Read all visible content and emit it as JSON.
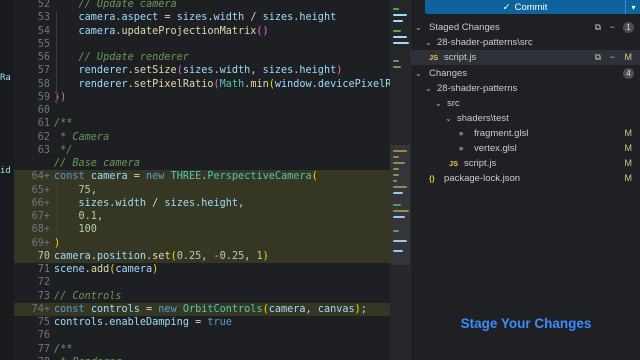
{
  "editor": {
    "lines": [
      {
        "n": "52",
        "tokens": [
          [
            "tk-cm",
            "    // Update camera"
          ]
        ]
      },
      {
        "n": "53",
        "tokens": [
          [
            "tk-var",
            "    camera"
          ],
          [
            "tk-pun",
            "."
          ],
          [
            "tk-var",
            "aspect"
          ],
          [
            "tk-pun",
            " = "
          ],
          [
            "tk-var",
            "sizes"
          ],
          [
            "tk-pun",
            "."
          ],
          [
            "tk-var",
            "width"
          ],
          [
            "tk-pun",
            " / "
          ],
          [
            "tk-var",
            "sizes"
          ],
          [
            "tk-pun",
            "."
          ],
          [
            "tk-var",
            "height"
          ]
        ]
      },
      {
        "n": "54",
        "tokens": [
          [
            "tk-var",
            "    camera"
          ],
          [
            "tk-pun",
            "."
          ],
          [
            "tk-fn",
            "updateProjectionMatrix"
          ],
          [
            "tk-br2",
            "()"
          ]
        ]
      },
      {
        "n": "55",
        "tokens": []
      },
      {
        "n": "56",
        "tokens": [
          [
            "tk-cm",
            "    // Update renderer"
          ]
        ]
      },
      {
        "n": "57",
        "tokens": [
          [
            "tk-var",
            "    renderer"
          ],
          [
            "tk-pun",
            "."
          ],
          [
            "tk-fn",
            "setSize"
          ],
          [
            "tk-br2",
            "("
          ],
          [
            "tk-var",
            "sizes"
          ],
          [
            "tk-pun",
            "."
          ],
          [
            "tk-var",
            "width"
          ],
          [
            "tk-pun",
            ", "
          ],
          [
            "tk-var",
            "sizes"
          ],
          [
            "tk-pun",
            "."
          ],
          [
            "tk-var",
            "height"
          ],
          [
            "tk-br2",
            ")"
          ]
        ]
      },
      {
        "n": "58",
        "tokens": [
          [
            "tk-var",
            "    renderer"
          ],
          [
            "tk-pun",
            "."
          ],
          [
            "tk-fn",
            "setPixelRatio"
          ],
          [
            "tk-br2",
            "("
          ],
          [
            "tk-cls",
            "Math"
          ],
          [
            "tk-pun",
            "."
          ],
          [
            "tk-fn",
            "min"
          ],
          [
            "tk-br1",
            "("
          ],
          [
            "tk-var",
            "window"
          ],
          [
            "tk-pun",
            "."
          ],
          [
            "tk-var",
            "devicePixelRa"
          ]
        ]
      },
      {
        "n": "59",
        "tokens": [
          [
            "tk-br2",
            "})"
          ]
        ]
      },
      {
        "n": "60",
        "tokens": []
      },
      {
        "n": "61",
        "tokens": [
          [
            "tk-cm",
            "/**"
          ]
        ]
      },
      {
        "n": "62",
        "tokens": [
          [
            "tk-cm",
            " * Camera"
          ]
        ]
      },
      {
        "n": "63",
        "tokens": [
          [
            "tk-cm",
            " */"
          ]
        ]
      },
      {
        "n": "",
        "tokens": [
          [
            "tk-cm",
            "// Base camera"
          ]
        ]
      },
      {
        "n": "64+",
        "hl": true,
        "tokens": [
          [
            "tk-kw",
            "const "
          ],
          [
            "tk-var",
            "camera"
          ],
          [
            "tk-pun",
            " = "
          ],
          [
            "tk-kw",
            "new "
          ],
          [
            "tk-cls",
            "THREE"
          ],
          [
            "tk-pun",
            "."
          ],
          [
            "tk-cls",
            "PerspectiveCamera"
          ],
          [
            "tk-br1",
            "("
          ]
        ]
      },
      {
        "n": "65+",
        "hl": true,
        "tokens": [
          [
            "tk-num",
            "    75"
          ],
          [
            "tk-pun",
            ","
          ]
        ]
      },
      {
        "n": "66+",
        "hl": true,
        "tokens": [
          [
            "tk-var",
            "    sizes"
          ],
          [
            "tk-pun",
            "."
          ],
          [
            "tk-var",
            "width"
          ],
          [
            "tk-pun",
            " / "
          ],
          [
            "tk-var",
            "sizes"
          ],
          [
            "tk-pun",
            "."
          ],
          [
            "tk-var",
            "height"
          ],
          [
            "tk-pun",
            ","
          ]
        ]
      },
      {
        "n": "67+",
        "hl": true,
        "tokens": [
          [
            "tk-num",
            "    0.1"
          ],
          [
            "tk-pun",
            ","
          ]
        ]
      },
      {
        "n": "68+",
        "hl": true,
        "tokens": [
          [
            "tk-num",
            "    100"
          ]
        ]
      },
      {
        "n": "69+",
        "hl": true,
        "tokens": [
          [
            "tk-br1",
            ")"
          ]
        ]
      },
      {
        "n": "70",
        "hl": true,
        "active": true,
        "tokens": [
          [
            "tk-var",
            "camera"
          ],
          [
            "tk-pun",
            "."
          ],
          [
            "tk-var",
            "position"
          ],
          [
            "tk-pun",
            "."
          ],
          [
            "tk-fn",
            "set"
          ],
          [
            "tk-br1",
            "("
          ],
          [
            "tk-num",
            "0.25"
          ],
          [
            "tk-pun",
            ", "
          ],
          [
            "tk-num",
            "-0.25"
          ],
          [
            "tk-pun",
            ", "
          ],
          [
            "tk-num",
            "1"
          ],
          [
            "tk-br1",
            ")"
          ]
        ]
      },
      {
        "n": "71",
        "tokens": [
          [
            "tk-var",
            "scene"
          ],
          [
            "tk-pun",
            "."
          ],
          [
            "tk-fn",
            "add"
          ],
          [
            "tk-br1",
            "("
          ],
          [
            "tk-var",
            "camera"
          ],
          [
            "tk-br1",
            ")"
          ]
        ]
      },
      {
        "n": "72",
        "tokens": []
      },
      {
        "n": "73",
        "tokens": [
          [
            "tk-cm",
            "// Controls"
          ]
        ]
      },
      {
        "n": "74+",
        "hl": true,
        "tokens": [
          [
            "tk-kw",
            "const "
          ],
          [
            "tk-var",
            "controls"
          ],
          [
            "tk-pun",
            " = "
          ],
          [
            "tk-kw",
            "new "
          ],
          [
            "tk-cls",
            "OrbitControls"
          ],
          [
            "tk-br1",
            "("
          ],
          [
            "tk-var",
            "camera"
          ],
          [
            "tk-pun",
            ", "
          ],
          [
            "tk-var",
            "canvas"
          ],
          [
            "tk-br1",
            ")"
          ],
          [
            "tk-pun",
            ";"
          ]
        ]
      },
      {
        "n": "75",
        "tokens": [
          [
            "tk-var",
            "controls"
          ],
          [
            "tk-pun",
            "."
          ],
          [
            "tk-var",
            "enableDamping"
          ],
          [
            "tk-pun",
            " = "
          ],
          [
            "tk-kw",
            "true"
          ]
        ]
      },
      {
        "n": "76",
        "tokens": []
      },
      {
        "n": "77",
        "tokens": [
          [
            "tk-cm",
            "/**"
          ]
        ]
      },
      {
        "n": "78",
        "tokens": [
          [
            "tk-cm",
            " * Renderer"
          ]
        ]
      }
    ],
    "left_fragments": [
      "Ra",
      "id"
    ]
  },
  "scm": {
    "commit_label": "Commit",
    "commit_icon": "check-icon",
    "staged_header": "Staged Changes",
    "staged_count": "1",
    "staged_folder": "28-shader-patterns\\src",
    "staged_file": "script.js",
    "staged_file_status": "M",
    "changes_header": "Changes",
    "changes_count": "4",
    "tree": [
      {
        "label": "28-shader-patterns",
        "kind": "folder",
        "indent": 1
      },
      {
        "label": "src",
        "kind": "folder",
        "indent": 2
      },
      {
        "label": "shaders\\test",
        "kind": "folder",
        "indent": 3
      },
      {
        "label": "fragment.glsl",
        "kind": "glsl",
        "indent": 4,
        "status": "M"
      },
      {
        "label": "vertex.glsl",
        "kind": "glsl",
        "indent": 4,
        "status": "M"
      },
      {
        "label": "script.js",
        "kind": "js",
        "indent": 3,
        "status": "M"
      },
      {
        "label": "package-lock.json",
        "kind": "json",
        "indent": 1,
        "status": "M"
      }
    ],
    "caption": "Stage Your Changes"
  },
  "colors": {
    "accent": "#0e639c",
    "caption": "#3b8cff",
    "modified": "#e2c08d"
  }
}
